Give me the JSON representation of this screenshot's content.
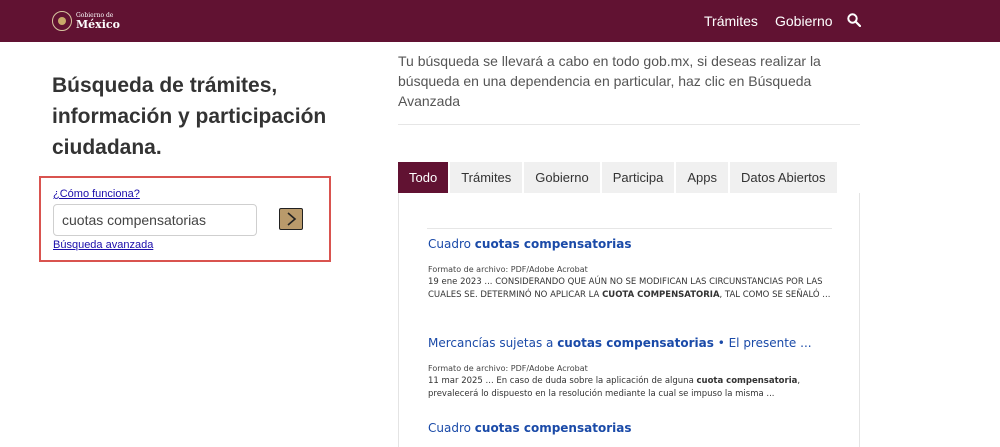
{
  "header": {
    "logo_small": "Gobierno de",
    "logo_big": "México",
    "nav": [
      "Trámites",
      "Gobierno"
    ],
    "search_icon": "search-icon",
    "colors": {
      "brand": "#611232"
    }
  },
  "page": {
    "title": "Búsqueda de trámites, información y participación ciudadana.",
    "intro": "Tu búsqueda se llevará a cabo en todo gob.mx, si deseas realizar la búsqueda en una dependencia en particular, haz clic en Búsqueda Avanzada"
  },
  "search": {
    "how_link": "¿Cómo funciona?",
    "query": "cuotas compensatorias",
    "go_icon": "chevron-right-icon",
    "advanced_link": "Búsqueda avanzada",
    "highlight_color": "#d9534f",
    "button_color": "#b99a6b"
  },
  "tabs": {
    "items": [
      "Todo",
      "Trámites",
      "Gobierno",
      "Participa",
      "Apps",
      "Datos Abiertos"
    ],
    "active": "Todo"
  },
  "results": [
    {
      "title_prefix": "Cuadro ",
      "title_bold": "cuotas compensatorias",
      "title_suffix": "",
      "format": "Formato de archivo: PDF/Adobe Acrobat",
      "snippet_1": "19 ene 2023 ... CONSIDERANDO QUE AÚN NO SE MODIFICAN LAS CIRCUNSTANCIAS POR LAS CUALES SE. DETERMINÓ NO APLICAR LA ",
      "snippet_bold": "CUOTA COMPENSATORIA",
      "snippet_2": ", TAL COMO SE SEÑALÓ ..."
    },
    {
      "title_prefix": "Mercancías sujetas a ",
      "title_bold": "cuotas compensatorias",
      "title_suffix": " • El presente ...",
      "format": "Formato de archivo: PDF/Adobe Acrobat",
      "snippet_1": "11 mar 2025 ... En caso de duda sobre la aplicación de alguna ",
      "snippet_bold": "cuota compensatoria",
      "snippet_2": ", prevalecerá lo dispuesto en la resolución mediante la cual se impuso la misma ..."
    },
    {
      "title_prefix": "Cuadro ",
      "title_bold": "cuotas compensatorias",
      "title_suffix": ""
    }
  ]
}
